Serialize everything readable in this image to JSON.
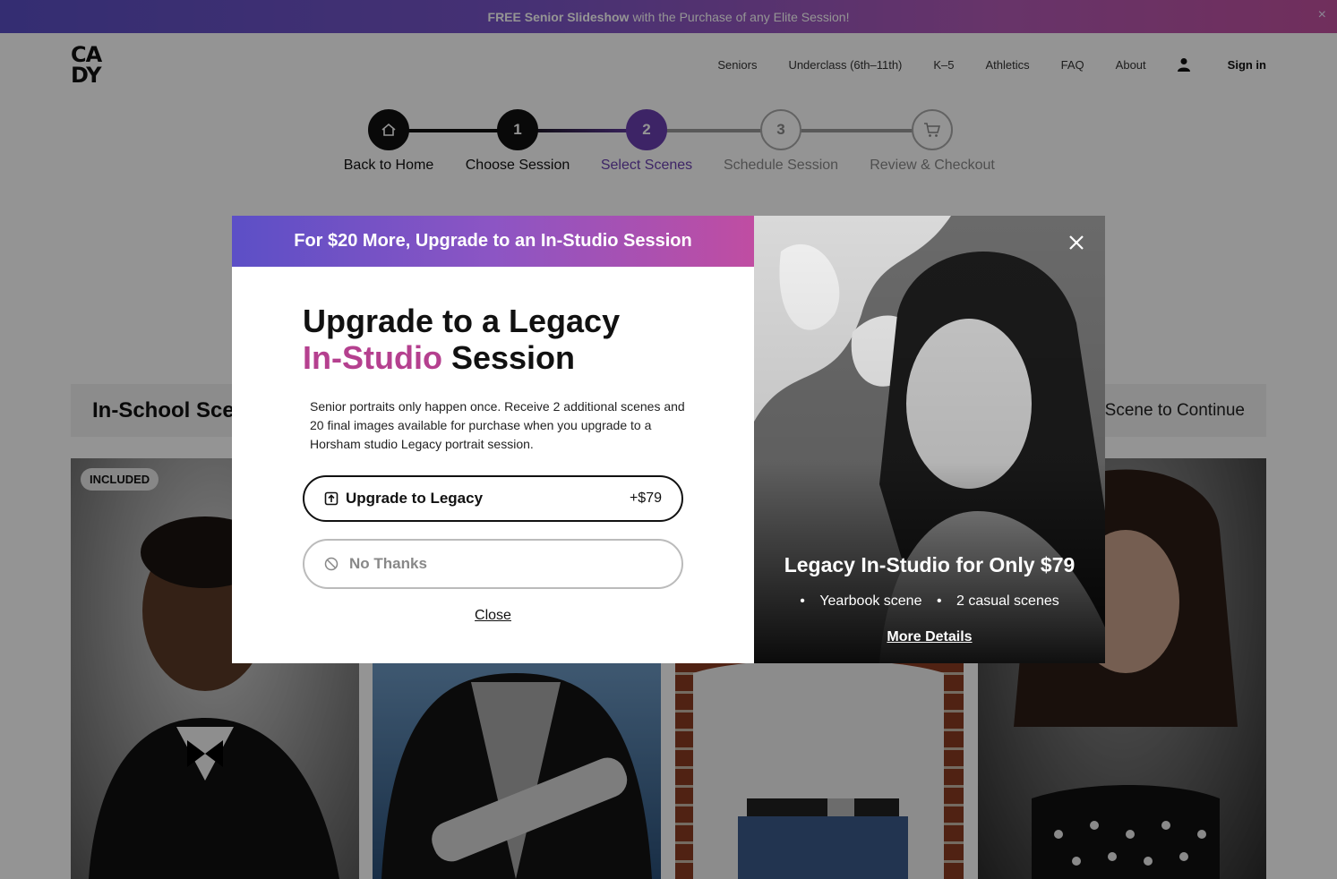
{
  "promo": {
    "bold": "FREE Senior Slideshow",
    "text": "with the Purchase of any Elite Session!",
    "close_glyph": "×"
  },
  "brand": {
    "logo_line1": "CA",
    "logo_line2": "DY"
  },
  "nav": {
    "items": [
      "Seniors",
      "Underclass (6th–11th)",
      "K–5",
      "Athletics",
      "FAQ",
      "About"
    ],
    "signin": "Sign in"
  },
  "stepper": {
    "steps": [
      {
        "number": "",
        "icon": "home-icon",
        "label": "Back to Home",
        "state": "done"
      },
      {
        "number": "1",
        "label": "Choose Session",
        "state": "done"
      },
      {
        "number": "2",
        "label": "Select Scenes",
        "state": "active"
      },
      {
        "number": "3",
        "label": "Schedule Session",
        "state": "upcoming"
      },
      {
        "number": "",
        "icon": "cart-icon",
        "label": "Review & Checkout",
        "state": "upcoming"
      }
    ]
  },
  "scenes": {
    "title": "In-School Scenes",
    "cta": "Select a Scene to Continue",
    "badge": "INCLUDED"
  },
  "modal": {
    "banner": "For $20 More, Upgrade to an In-Studio Session",
    "heading_line1": "Upgrade to a Legacy",
    "heading_accent": "In-Studio",
    "heading_rest": "Session",
    "body": "Senior portraits only happen once. Receive 2 additional scenes and 20 final images available for purchase when you upgrade to a Horsham studio Legacy portrait session.",
    "upgrade_label": "Upgrade to Legacy",
    "upgrade_price": "+$79",
    "no_thanks_label": "No Thanks",
    "close_label": "Close",
    "side_title": "Legacy In-Studio for Only $79",
    "side_bullets": [
      "Yearbook scene",
      "2 casual scenes"
    ],
    "side_link": "More Details"
  },
  "colors": {
    "accent": "#b5408f",
    "active_step": "#6a3fb0",
    "gradient_start": "#5c4fc6",
    "gradient_end": "#c04da2"
  }
}
